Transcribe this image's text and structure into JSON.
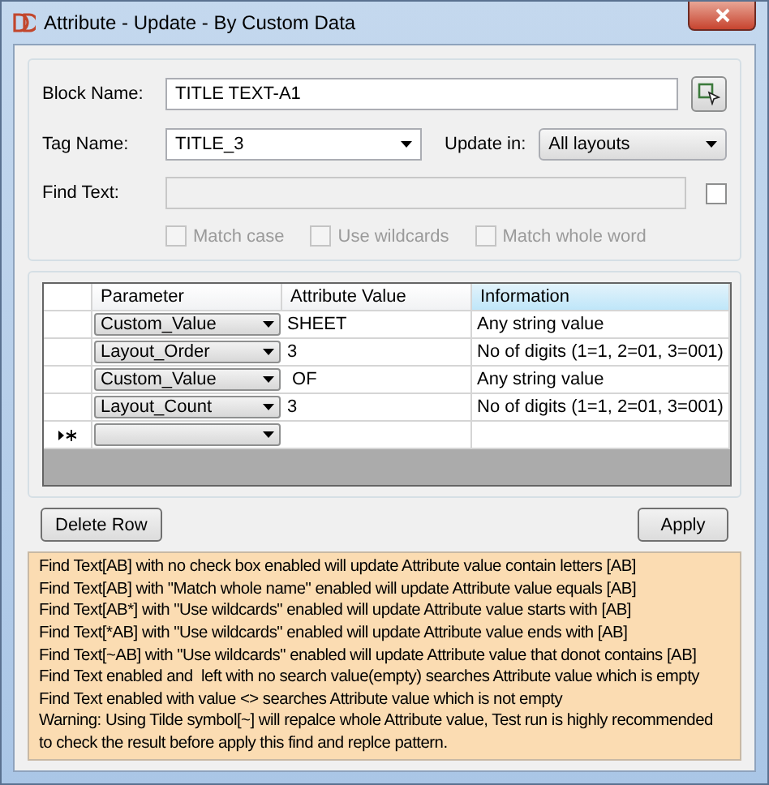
{
  "window": {
    "title": "Attribute - Update - By Custom Data"
  },
  "block_name": {
    "label": "Block Name:",
    "value": "TITLE TEXT-A1"
  },
  "tag_name": {
    "label": "Tag Name:",
    "value": "TITLE_3"
  },
  "update_in": {
    "label": "Update in:",
    "value": "All layouts"
  },
  "find_text": {
    "label": "Find Text:",
    "disabled": true,
    "checked": false
  },
  "options": [
    {
      "label": "Match case",
      "checked": false,
      "disabled": true
    },
    {
      "label": "Use wildcards",
      "checked": false,
      "disabled": true
    },
    {
      "label": "Match whole word",
      "checked": false,
      "disabled": true
    }
  ],
  "grid": {
    "columns": [
      {
        "label": "Parameter",
        "selected": false
      },
      {
        "label": "Attribute Value",
        "selected": false
      },
      {
        "label": "Information",
        "selected": true
      }
    ],
    "rows": [
      {
        "parameter": "Custom_Value",
        "value": "SHEET",
        "information": "Any string value"
      },
      {
        "parameter": "Layout_Order",
        "value": "3",
        "information": "No of digits (1=1, 2=01, 3=001)"
      },
      {
        "parameter": "Custom_Value",
        "value": " OF",
        "information": "Any string value"
      },
      {
        "parameter": "Layout_Count",
        "value": "3",
        "information": "No of digits (1=1, 2=01, 3=001)"
      }
    ]
  },
  "buttons": [
    "Delete Row",
    "Apply"
  ],
  "help_lines": [
    "Find Text[AB] with no check box enabled will update Attribute value contain letters [AB]",
    "Find Text[AB] with \"Match whole name\" enabled will update Attribute value equals [AB]",
    "Find Text[AB*] with \"Use wildcards\" enabled will update Attribute value starts with [AB]",
    "Find Text[*AB] with \"Use wildcards\" enabled will update Attribute value ends with [AB]",
    "Find Text[~AB] with \"Use wildcards\" enabled will update Attribute value that donot contains [AB]",
    "Find Text enabled and  left with no search value(empty) searches Attribute value which is empty",
    "Find Text enabled with value <> searches Attribute value which is not empty",
    "Warning: Using Tilde symbol[~] will repalce whole Attribute value, Test run is highly recommended",
    "to check the result before apply this find and replce pattern."
  ]
}
